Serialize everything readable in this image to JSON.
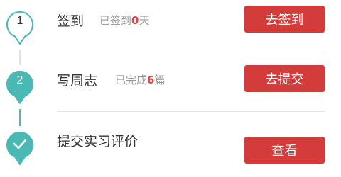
{
  "colors": {
    "accent": "#d43b3b",
    "teal": "#4ab9b4",
    "text": "#333333",
    "muted": "#9a9a9a",
    "count": "#d54a4a"
  },
  "steps": [
    {
      "number": "1",
      "status": "current",
      "title": "签到",
      "sub_prefix": "已签到",
      "sub_count": "0",
      "sub_suffix": "天",
      "button": "去签到"
    },
    {
      "number": "2",
      "status": "active",
      "title": "写周志",
      "sub_prefix": "已完成",
      "sub_count": "6",
      "sub_suffix": "篇",
      "button": "去提交"
    },
    {
      "status": "done",
      "icon": "check-icon",
      "title": "提交实习评价",
      "button": "查看"
    }
  ]
}
